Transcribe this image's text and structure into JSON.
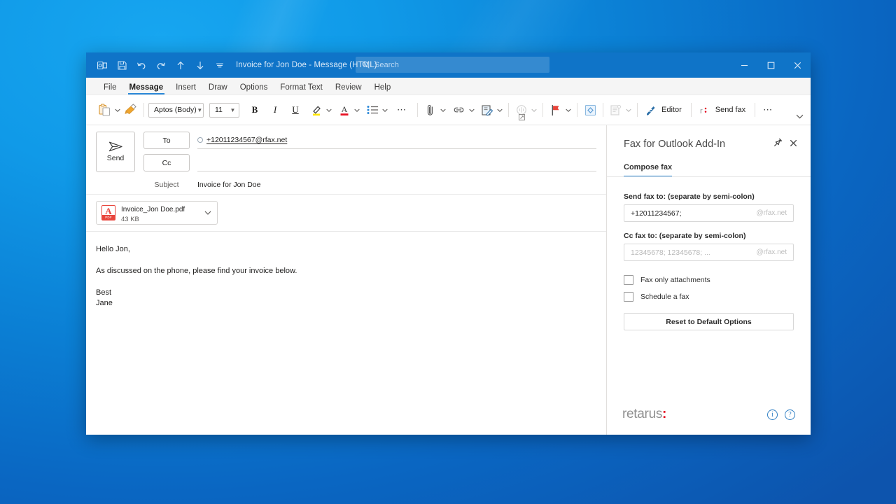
{
  "window": {
    "title": "Invoice for Jon Doe  -  Message (HTML)",
    "quick_access": [
      "outlook-icon",
      "save-icon",
      "undo-icon",
      "redo-icon",
      "up-icon",
      "down-icon",
      "customize-icon"
    ],
    "search_placeholder": "Search",
    "controls": {
      "minimize": "—",
      "maximize": "□",
      "close": "×"
    },
    "accent": "#0f74c8"
  },
  "ribbon": {
    "tabs": [
      {
        "label": "File",
        "active": false
      },
      {
        "label": "Message",
        "active": true
      },
      {
        "label": "Insert",
        "active": false
      },
      {
        "label": "Draw",
        "active": false
      },
      {
        "label": "Options",
        "active": false
      },
      {
        "label": "Format Text",
        "active": false
      },
      {
        "label": "Review",
        "active": false
      },
      {
        "label": "Help",
        "active": false
      }
    ],
    "font_name": "Aptos (Body)",
    "font_size": "11",
    "bold_label": "B",
    "italic_label": "I",
    "underline_label": "U",
    "overflow_label": "⋯",
    "editor_label": "Editor",
    "send_fax_label": "Send fax",
    "more_label": "⋯"
  },
  "compose": {
    "send_label": "Send",
    "to_label": "To",
    "cc_label": "Cc",
    "to_value": "+12011234567@rfax.net",
    "cc_value": "",
    "subject_label": "Subject",
    "subject_value": "Invoice for Jon Doe",
    "attachment": {
      "name": "Invoice_Jon Doe.pdf",
      "size": "43 KB",
      "type": "PDF"
    },
    "body": {
      "greeting": "Hello Jon,",
      "paragraph": "As discussed on the phone, please find your invoice below.",
      "sign_off": "Best",
      "signature": "Jane"
    }
  },
  "addin": {
    "title": "Fax for Outlook Add-In",
    "pin_icon": "pin-icon",
    "close_icon": "close-icon",
    "tab_label": "Compose fax",
    "send_fax_label": "Send fax to: (separate by semi-colon)",
    "send_fax_value": "+12011234567;",
    "send_fax_suffix": "@rfax.net",
    "cc_fax_label": "Cc fax to: (separate by semi-colon)",
    "cc_fax_value": "",
    "cc_fax_placeholder": "12345678; 12345678; ...",
    "cc_fax_suffix": "@rfax.net",
    "checkbox_attachments": "Fax only attachments",
    "checkbox_schedule": "Schedule a fax",
    "checkbox_attachments_checked": false,
    "checkbox_schedule_checked": false,
    "reset_label": "Reset to Default Options",
    "brand_name": "retarus",
    "brand_dots": ":",
    "brand_accent": "#e2001a",
    "info_icon": "i",
    "help_icon": "?"
  }
}
